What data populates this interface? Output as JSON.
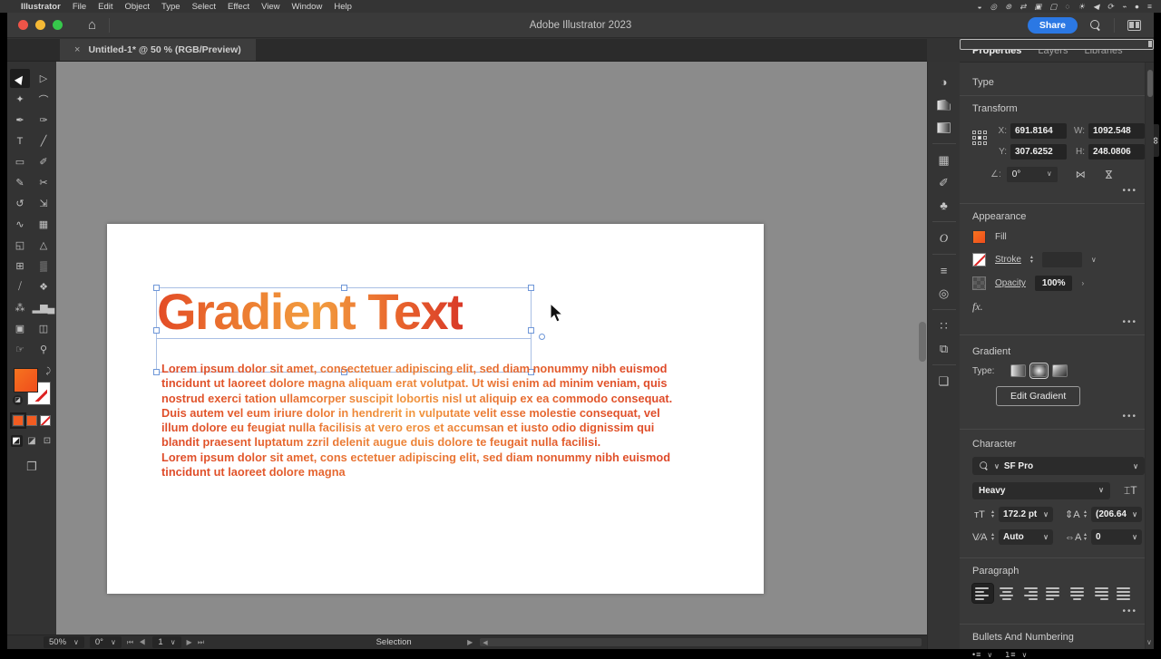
{
  "menubar": {
    "apple": "",
    "items": [
      "Illustrator",
      "File",
      "Edit",
      "Object",
      "Type",
      "Select",
      "Effect",
      "View",
      "Window",
      "Help"
    ],
    "status_icons": [
      "◒",
      "◎",
      "⊛",
      "⇄",
      "▣",
      "▢",
      "◌",
      "☀",
      "◀",
      "⟳",
      "⌁",
      "●",
      "≡"
    ]
  },
  "titlebar": {
    "title": "Adobe Illustrator 2023",
    "share_label": "Share"
  },
  "tab": {
    "close": "×",
    "label": "Untitled-1* @ 50 % (RGB/Preview)"
  },
  "toolbar": {
    "tools": [
      {
        "name": "selection-tool",
        "glyph": "▶",
        "active": true
      },
      {
        "name": "direct-selection-tool",
        "glyph": "▷"
      },
      {
        "name": "magic-wand-tool",
        "glyph": "✦"
      },
      {
        "name": "lasso-tool",
        "glyph": "⌒"
      },
      {
        "name": "pen-tool",
        "glyph": "✒"
      },
      {
        "name": "curvature-tool",
        "glyph": "✑"
      },
      {
        "name": "type-tool",
        "glyph": "T"
      },
      {
        "name": "line-segment-tool",
        "glyph": "╱"
      },
      {
        "name": "rectangle-tool",
        "glyph": "▭"
      },
      {
        "name": "paintbrush-tool",
        "glyph": "✐"
      },
      {
        "name": "shaper-tool",
        "glyph": "✎"
      },
      {
        "name": "scissors-tool",
        "glyph": "✂"
      },
      {
        "name": "rotate-tool",
        "glyph": "↺"
      },
      {
        "name": "scale-tool",
        "glyph": "⇲"
      },
      {
        "name": "width-tool",
        "glyph": "∿"
      },
      {
        "name": "free-transform-tool",
        "glyph": "▦"
      },
      {
        "name": "shape-builder-tool",
        "glyph": "◱"
      },
      {
        "name": "perspective-grid-tool",
        "glyph": "△"
      },
      {
        "name": "mesh-tool",
        "glyph": "⊞"
      },
      {
        "name": "gradient-tool",
        "glyph": "▒"
      },
      {
        "name": "eyedropper-tool",
        "glyph": "⧸"
      },
      {
        "name": "blend-tool",
        "glyph": "❖"
      },
      {
        "name": "symbol-sprayer-tool",
        "glyph": "⁂"
      },
      {
        "name": "column-graph-tool",
        "glyph": "▂▆▄"
      },
      {
        "name": "artboard-tool",
        "glyph": "▣"
      },
      {
        "name": "slice-tool",
        "glyph": "◫"
      },
      {
        "name": "hand-tool",
        "glyph": "☞"
      },
      {
        "name": "zoom-tool",
        "glyph": "⚲"
      }
    ]
  },
  "canvas": {
    "headline": "Gradient Text",
    "body_par1": "Lorem ipsum dolor sit amet, consectetuer adipiscing elit, sed diam nonummy nibh euismod tincidunt ut laoreet dolore magna aliquam erat volutpat. Ut wisi enim ad minim veniam, quis nostrud exerci tation ullamcorper suscipit lobortis nisl ut aliquip ex ea commodo consequat. Duis autem vel eum iriure dolor in hendrerit in vulputate velit esse molestie consequat, vel illum dolore eu feugiat nulla facilisis at vero eros et accumsan et iusto odio dignissim qui blandit praesent luptatum zzril delenit augue duis dolore te feugait nulla facilisi.",
    "body_par2": "Lorem ipsum dolor sit amet, cons ectetuer adipiscing elit, sed diam nonummy nibh euismod tincidunt ut laoreet dolore magna"
  },
  "dock": {
    "icons": [
      {
        "name": "color-panel-icon",
        "glyph": "◑"
      },
      {
        "name": "gradient-panel-icon",
        "glyph": ""
      },
      {
        "name": "stroke-swatch-panel-icon",
        "glyph": ""
      },
      {
        "name": "artboards-panel-icon",
        "glyph": "▦"
      },
      {
        "name": "brushes-panel-icon",
        "glyph": "✐"
      },
      {
        "name": "symbols-panel-icon",
        "glyph": "♣"
      },
      {
        "name": "opentype-panel-icon",
        "glyph": "O"
      },
      {
        "name": "stroke-panel-icon",
        "glyph": "≡"
      },
      {
        "name": "transparency-panel-icon",
        "glyph": "◎"
      },
      {
        "name": "appearance-panel-icon",
        "glyph": "∷"
      },
      {
        "name": "graphic-styles-panel-icon",
        "glyph": "⧉"
      },
      {
        "name": "layers-panel-icon",
        "glyph": "❏"
      }
    ]
  },
  "panel": {
    "tabs": [
      {
        "label": "Properties",
        "active": true
      },
      {
        "label": "Layers"
      },
      {
        "label": "Libraries"
      }
    ],
    "type_section": "Type",
    "transform": {
      "label": "Transform",
      "x_label": "X:",
      "x": "691.8164",
      "y_label": "Y:",
      "y": "307.6252",
      "w_label": "W:",
      "w": "1092.548",
      "h_label": "H:",
      "h": "248.0806",
      "angle_label": "∠:",
      "angle": "0°",
      "chain_glyph": "∞",
      "flip_h": "⋈",
      "flip_v": "⋈",
      "more": "•••"
    },
    "appearance": {
      "label": "Appearance",
      "fill_label": "Fill",
      "stroke_label": "Stroke",
      "opacity_label": "Opacity",
      "opacity_value": "100%",
      "opacity_chevron": "›",
      "fx_label": "fx.",
      "more": "•••"
    },
    "gradient": {
      "label": "Gradient",
      "type_label": "Type:",
      "edit_button": "Edit Gradient",
      "more": "•••"
    },
    "character": {
      "label": "Character",
      "font": "SF Pro",
      "style": "Heavy",
      "size_icon": "тT",
      "size": "172.2 pt",
      "leading_icon": "⇕A",
      "leading": "(206.64",
      "kerning_icon": "V⁄A",
      "kerning": "Auto",
      "tracking_icon": "⇔A",
      "tracking": "0",
      "touch_type_icon": "⌶T"
    },
    "paragraph": {
      "label": "Paragraph",
      "aligns": [
        {
          "name": "align-left-button",
          "variant": "basic",
          "active": true
        },
        {
          "name": "align-center-button",
          "variant": "basic v-center"
        },
        {
          "name": "align-right-button",
          "variant": "basic v-right"
        },
        {
          "name": "justify-left-button",
          "variant": "jst"
        },
        {
          "name": "justify-center-button",
          "variant": "jst v-center"
        },
        {
          "name": "justify-right-button",
          "variant": "jst v-right"
        },
        {
          "name": "justify-all-button",
          "variant": ""
        }
      ],
      "more": "•••"
    },
    "bullets": {
      "label": "Bullets And Numbering",
      "bullet_glyph": "•≡",
      "number_glyph": "1≡"
    }
  },
  "statusbar": {
    "zoom": "50%",
    "rotation": "0°",
    "nav_prev": "⏮ ◀",
    "page": "1",
    "nav_next": "▶ ⏭",
    "mode_label": "Selection",
    "play": "▶"
  },
  "colors": {
    "accent_red_highlight": "#e42312",
    "share_blue": "#2b78e4",
    "fill_orange": "#f25c21",
    "gradient_start": "#e34b26",
    "gradient_mid": "#f29d3f",
    "gradient_end": "#d93928"
  }
}
